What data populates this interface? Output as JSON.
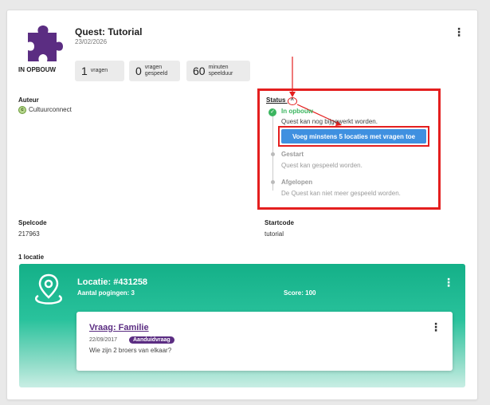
{
  "quest": {
    "title": "Quest: Tutorial",
    "date": "23/02/2026",
    "status": "IN OPBOUW",
    "menu_icon": "kebab-vertical-icon"
  },
  "stats": [
    {
      "num": "1",
      "label_line1": "vragen",
      "label_line2": ""
    },
    {
      "num": "0",
      "label_line1": "vragen",
      "label_line2": "gespeeld"
    },
    {
      "num": "60",
      "label_line1": "minuten",
      "label_line2": "speelduur"
    }
  ],
  "author": {
    "label": "Auteur",
    "value": "Cultuurconnect"
  },
  "status_panel": {
    "header": "Status",
    "steps": [
      {
        "title": "In opbouw",
        "desc": "Quest kan nog bijgewerkt worden."
      },
      {
        "title": "Gestart",
        "desc": "Quest kan gespeeld worden."
      },
      {
        "title": "Afgelopen",
        "desc": "De Quest kan niet meer gespeeld worden."
      }
    ],
    "button_label": "Voeg minstens 5 locaties met vragen toe"
  },
  "codes": {
    "speelcode_label": "Spelcode",
    "speelcode_value": "217963",
    "startcode_label": "Startcode",
    "startcode_value": "tutorial"
  },
  "locations": {
    "count_label": "1 locatie",
    "items": [
      {
        "title": "Locatie: #431258",
        "attempts": "Aantal pogingen: 3",
        "score": "Score: 100",
        "question": {
          "title": "Vraag: Familie",
          "date": "22/09/2017",
          "badge": "Aanduidvraag",
          "text": "Wie zijn 2 broers van elkaar?"
        }
      }
    ]
  },
  "colors": {
    "accent_purple": "#5b2d82",
    "active_green": "#3bb55f",
    "button_blue": "#3f90e0",
    "annotation_red": "#e41f1f",
    "location_teal": "#14b088"
  }
}
